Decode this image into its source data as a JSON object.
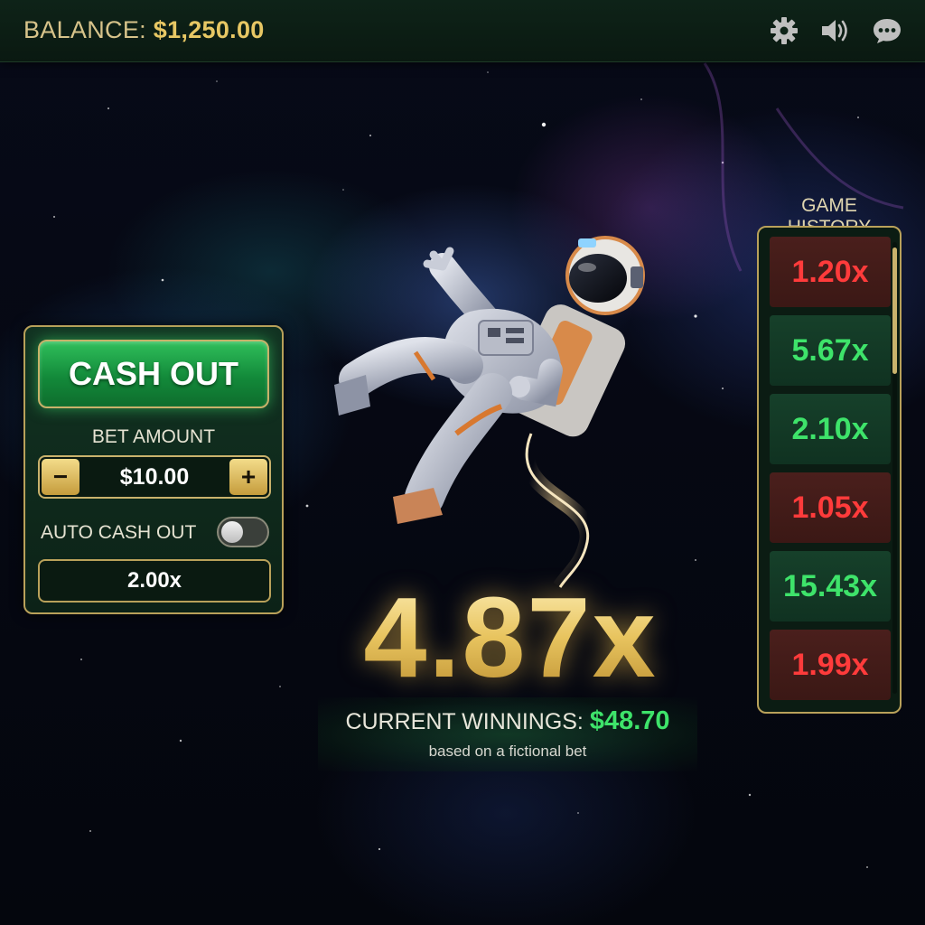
{
  "header": {
    "balance_label": "BALANCE:",
    "balance_value": "$1,250.00",
    "icons": [
      "gear-icon",
      "speaker-icon",
      "chat-icon"
    ]
  },
  "controls": {
    "cash_out_label": "CASH OUT",
    "bet_amount_label": "BET AMOUNT",
    "bet_minus": "−",
    "bet_value": "$10.00",
    "bet_plus": "+",
    "auto_cash_out_label": "AUTO CASH OUT",
    "auto_cash_out_enabled": false,
    "auto_cash_out_value": "2.00x"
  },
  "game": {
    "multiplier": "4.87x",
    "winnings_label": "CURRENT WINNINGS:",
    "winnings_value": "$48.70",
    "winnings_note": "based on a fictional bet"
  },
  "history": {
    "title": "GAME HISTORY",
    "items": [
      {
        "value": "1.20x",
        "result": "loss"
      },
      {
        "value": "5.67x",
        "result": "win"
      },
      {
        "value": "2.10x",
        "result": "win"
      },
      {
        "value": "1.05x",
        "result": "loss"
      },
      {
        "value": "15.43x",
        "result": "win"
      },
      {
        "value": "1.99x",
        "result": "loss"
      }
    ]
  },
  "colors": {
    "accent_gold": "#e7c764",
    "win_green": "#3ee36a",
    "loss_red": "#ff3b3b",
    "panel_green": "#123322"
  }
}
